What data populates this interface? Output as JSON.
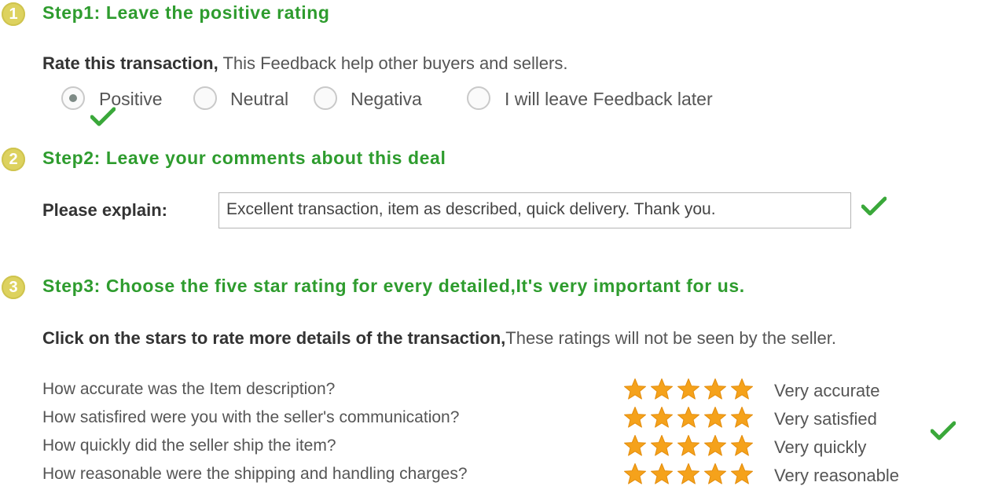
{
  "step1": {
    "number": "1",
    "title": "Step1: Leave the positive rating",
    "rate_lead": "Rate this transaction,",
    "rate_text": "This Feedback help other buyers and sellers.",
    "options": [
      {
        "label": "Positive",
        "selected": true
      },
      {
        "label": "Neutral",
        "selected": false
      },
      {
        "label": "Negativa",
        "selected": false
      },
      {
        "label": "I will leave Feedback later",
        "selected": false
      }
    ]
  },
  "step2": {
    "number": "2",
    "title": "Step2: Leave your comments about this deal",
    "explain_label": "Please explain:",
    "comment_value": "Excellent transaction, item as described, quick delivery. Thank you."
  },
  "step3": {
    "number": "3",
    "title": "Step3: Choose the five star rating for every detailed,It's very important for us.",
    "instruction_lead": "Click on the stars to rate more details of the transaction,",
    "instruction_text": "These ratings will not be seen by the seller.",
    "ratings": [
      {
        "question": "How accurate was the Item description?",
        "stars": 5,
        "max_stars": 5,
        "label": "Very accurate"
      },
      {
        "question": "How satisfired were you with the seller's communication?",
        "stars": 5,
        "max_stars": 5,
        "label": "Very satisfied"
      },
      {
        "question": "How quickly did the seller ship the item?",
        "stars": 5,
        "max_stars": 5,
        "label": "Very quickly"
      },
      {
        "question": "How reasonable were the shipping and handling charges?",
        "stars": 5,
        "max_stars": 5,
        "label": "Very reasonable"
      }
    ]
  },
  "colors": {
    "step_title": "#2e9c2e",
    "badge": "#ddd25f",
    "check": "#3aa83a",
    "star": "#f5a21b"
  },
  "icons": {
    "badge": "step-number-badge",
    "check": "checkmark-icon",
    "star": "star-icon"
  }
}
